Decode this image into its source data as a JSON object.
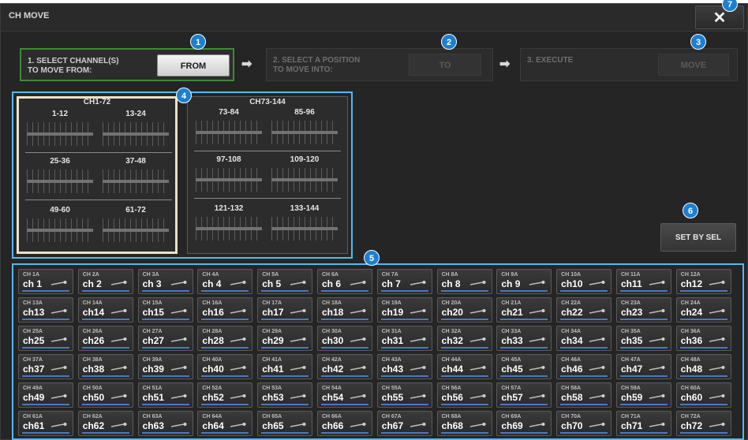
{
  "window": {
    "title": "CH MOVE",
    "close_label": "✕"
  },
  "steps": {
    "step1": {
      "text": "1. SELECT CHANNEL(S)\n    TO MOVE FROM:",
      "button": "FROM"
    },
    "step2": {
      "text": "2. SELECT A POSITION\n    TO MOVE INTO:",
      "button": "TO"
    },
    "step3": {
      "text": "3. EXECUTE",
      "button": "MOVE"
    },
    "arrow": "➡"
  },
  "badges": [
    "1",
    "2",
    "3",
    "4",
    "5",
    "6",
    "7"
  ],
  "banks": [
    {
      "title": "CH1-72",
      "groups": [
        "1-12",
        "13-24",
        "25-36",
        "37-48",
        "49-60",
        "61-72"
      ]
    },
    {
      "title": "CH73-144",
      "groups": [
        "73-84",
        "85-96",
        "97-108",
        "109-120",
        "121-132",
        "133-144"
      ]
    }
  ],
  "set_by_sel": "SET BY SEL",
  "channels": [
    {
      "id": "CH 1A",
      "name": "ch 1"
    },
    {
      "id": "CH 2A",
      "name": "ch 2"
    },
    {
      "id": "CH 3A",
      "name": "ch 3"
    },
    {
      "id": "CH 4A",
      "name": "ch 4"
    },
    {
      "id": "CH 5A",
      "name": "ch 5"
    },
    {
      "id": "CH 6A",
      "name": "ch 6"
    },
    {
      "id": "CH 7A",
      "name": "ch 7"
    },
    {
      "id": "CH 8A",
      "name": "ch 8"
    },
    {
      "id": "CH 9A",
      "name": "ch 9"
    },
    {
      "id": "CH 10A",
      "name": "ch10"
    },
    {
      "id": "CH 11A",
      "name": "ch11"
    },
    {
      "id": "CH 12A",
      "name": "ch12"
    },
    {
      "id": "CH 13A",
      "name": "ch13"
    },
    {
      "id": "CH 14A",
      "name": "ch14"
    },
    {
      "id": "CH 15A",
      "name": "ch15"
    },
    {
      "id": "CH 16A",
      "name": "ch16"
    },
    {
      "id": "CH 17A",
      "name": "ch17"
    },
    {
      "id": "CH 18A",
      "name": "ch18"
    },
    {
      "id": "CH 19A",
      "name": "ch19"
    },
    {
      "id": "CH 20A",
      "name": "ch20"
    },
    {
      "id": "CH 21A",
      "name": "ch21"
    },
    {
      "id": "CH 22A",
      "name": "ch22"
    },
    {
      "id": "CH 23A",
      "name": "ch23"
    },
    {
      "id": "CH 24A",
      "name": "ch24"
    },
    {
      "id": "CH 25A",
      "name": "ch25"
    },
    {
      "id": "CH 26A",
      "name": "ch26"
    },
    {
      "id": "CH 27A",
      "name": "ch27"
    },
    {
      "id": "CH 28A",
      "name": "ch28"
    },
    {
      "id": "CH 29A",
      "name": "ch29"
    },
    {
      "id": "CH 30A",
      "name": "ch30"
    },
    {
      "id": "CH 31A",
      "name": "ch31"
    },
    {
      "id": "CH 32A",
      "name": "ch32"
    },
    {
      "id": "CH 33A",
      "name": "ch33"
    },
    {
      "id": "CH 34A",
      "name": "ch34"
    },
    {
      "id": "CH 35A",
      "name": "ch35"
    },
    {
      "id": "CH 36A",
      "name": "ch36"
    },
    {
      "id": "CH 37A",
      "name": "ch37"
    },
    {
      "id": "CH 38A",
      "name": "ch38"
    },
    {
      "id": "CH 39A",
      "name": "ch39"
    },
    {
      "id": "CH 40A",
      "name": "ch40"
    },
    {
      "id": "CH 41A",
      "name": "ch41"
    },
    {
      "id": "CH 42A",
      "name": "ch42"
    },
    {
      "id": "CH 43A",
      "name": "ch43"
    },
    {
      "id": "CH 44A",
      "name": "ch44"
    },
    {
      "id": "CH 45A",
      "name": "ch45"
    },
    {
      "id": "CH 46A",
      "name": "ch46"
    },
    {
      "id": "CH 47A",
      "name": "ch47"
    },
    {
      "id": "CH 48A",
      "name": "ch48"
    },
    {
      "id": "CH 49A",
      "name": "ch49"
    },
    {
      "id": "CH 50A",
      "name": "ch50"
    },
    {
      "id": "CH 51A",
      "name": "ch51"
    },
    {
      "id": "CH 52A",
      "name": "ch52"
    },
    {
      "id": "CH 53A",
      "name": "ch53"
    },
    {
      "id": "CH 54A",
      "name": "ch54"
    },
    {
      "id": "CH 55A",
      "name": "ch55"
    },
    {
      "id": "CH 56A",
      "name": "ch56"
    },
    {
      "id": "CH 57A",
      "name": "ch57"
    },
    {
      "id": "CH 58A",
      "name": "ch58"
    },
    {
      "id": "CH 59A",
      "name": "ch59"
    },
    {
      "id": "CH 60A",
      "name": "ch60"
    },
    {
      "id": "CH 61A",
      "name": "ch61"
    },
    {
      "id": "CH 62A",
      "name": "ch62"
    },
    {
      "id": "CH 63A",
      "name": "ch63"
    },
    {
      "id": "CH 64A",
      "name": "ch64"
    },
    {
      "id": "CH 65A",
      "name": "ch65"
    },
    {
      "id": "CH 66A",
      "name": "ch66"
    },
    {
      "id": "CH 67A",
      "name": "ch67"
    },
    {
      "id": "CH 68A",
      "name": "ch68"
    },
    {
      "id": "CH 69A",
      "name": "ch69"
    },
    {
      "id": "CH 70A",
      "name": "ch70"
    },
    {
      "id": "CH 71A",
      "name": "ch71"
    },
    {
      "id": "CH 72A",
      "name": "ch72"
    }
  ],
  "colors": {
    "accent": "#56b8f0",
    "badge": "#1d7fd0",
    "step_active_border": "#3f8a39",
    "channel_underline": "#4a79c0"
  },
  "icons": {
    "channel": "microphone-icon",
    "close": "close-icon",
    "arrow": "arrow-right-icon"
  }
}
